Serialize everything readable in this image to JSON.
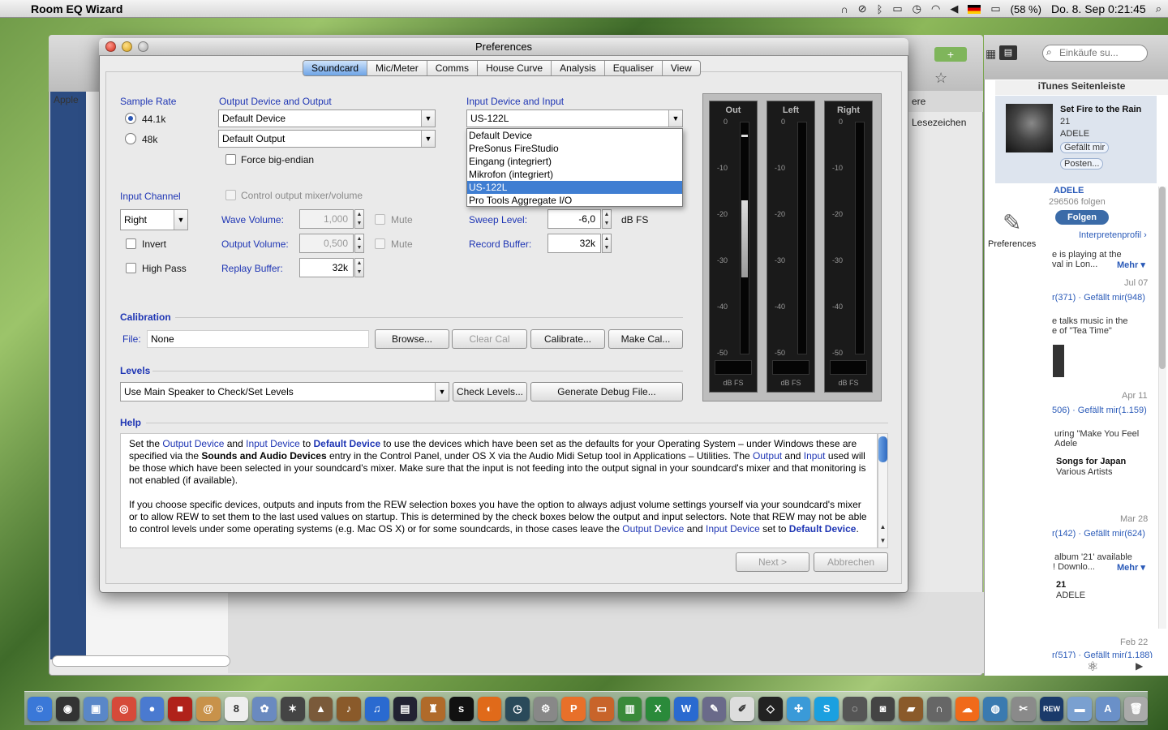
{
  "menubar": {
    "app_name": "Room EQ Wizard",
    "battery": "(58 %)",
    "clock": "Do. 8. Sep  0:21:45"
  },
  "background": {
    "apple_tab": "Apple",
    "lesezeichen": "ere Lesezeichen",
    "preferences_label": "Preferences"
  },
  "itunes": {
    "search_placeholder": "Einkäufe su...",
    "header": "iTunes Seitenleiste",
    "song": "Set Fire to the Rain",
    "album_num": "21",
    "artist": "ADELE",
    "like_btn": "Gefällt mir",
    "post_btn": "Posten...",
    "artist2": "ADELE",
    "followers": "296506 folgen",
    "follow_btn": "Folgen",
    "profile_link": "Interpretenprofil",
    "feed": [
      {
        "text1": "e is playing at the",
        "text2": "val in Lon...",
        "more": "Mehr",
        "date": "Jul 07",
        "stats": "r(371) · Gefällt mir(948)"
      },
      {
        "text1": "e talks music in the",
        "text2": "e of \"Tea Time\"",
        "date": "Apr 11",
        "stats": "506) · Gefällt mir(1.159)"
      },
      {
        "text1": "uring \"Make You Feel",
        "text2": "Adele",
        "title": "Songs for Japan",
        "sub": "Various Artists",
        "date": "Mar 28",
        "stats": "r(142) · Gefällt mir(624)"
      },
      {
        "text1": "album '21' available",
        "text2": "! Downlo...",
        "more": "Mehr",
        "title": "21",
        "sub": "ADELE",
        "date": "Feb 22",
        "stats": "r(517) · Gefällt mir(1.188)"
      }
    ]
  },
  "dialog": {
    "title": "Preferences",
    "tabs": [
      "Soundcard",
      "Mic/Meter",
      "Comms",
      "House Curve",
      "Analysis",
      "Equaliser",
      "View"
    ],
    "active_tab": "Soundcard",
    "sample_rate": {
      "label": "Sample Rate",
      "options": [
        "44.1k",
        "48k"
      ],
      "selected": "44.1k"
    },
    "output": {
      "label": "Output Device and Output",
      "device": "Default Device",
      "output": "Default Output",
      "force_big_endian": "Force big-endian"
    },
    "input": {
      "label": "Input Device and Input",
      "device": "US-122L",
      "dropdown_options": [
        "Default Device",
        "PreSonus FireStudio",
        "Eingang (integriert)",
        "Mikrofon (integriert)",
        "US-122L",
        "Pro Tools Aggregate I/O"
      ],
      "dropdown_selected": "US-122L"
    },
    "input_channel": {
      "label": "Input Channel",
      "value": "Right",
      "invert": "Invert",
      "high_pass": "High Pass"
    },
    "control_mixer": "Control output mixer/volume",
    "wave_volume": {
      "label": "Wave Volume:",
      "value": "1,000",
      "mute": "Mute"
    },
    "output_volume": {
      "label": "Output Volume:",
      "value": "0,500",
      "mute": "Mute"
    },
    "replay_buffer": {
      "label": "Replay Buffer:",
      "value": "32k"
    },
    "sweep_level": {
      "label": "Sweep Level:",
      "value": "-6,0",
      "unit": "dB FS"
    },
    "record_buffer": {
      "label": "Record Buffer:",
      "value": "32k"
    },
    "calibration": {
      "title": "Calibration",
      "file_label": "File:",
      "file_value": "None",
      "browse": "Browse...",
      "clear_cal": "Clear Cal",
      "calibrate": "Calibrate...",
      "make_cal": "Make Cal..."
    },
    "levels": {
      "title": "Levels",
      "mode": "Use Main Speaker to Check/Set Levels",
      "check_levels": "Check Levels...",
      "debug": "Generate Debug File..."
    },
    "meters": {
      "channels": [
        "Out",
        "Left",
        "Right"
      ],
      "ticks": [
        "0",
        "-10",
        "-20",
        "-30",
        "-40",
        "-50"
      ],
      "unit": "dB FS",
      "out_level_fraction": 0.33
    },
    "help": {
      "title": "Help",
      "p1": {
        "t1": "Set the ",
        "b1": "Output Device",
        "t2": " and ",
        "b2": "Input Device",
        "t3": " to ",
        "bb1": "Default Device",
        "t4": " to use the devices which have been set as the defaults for your Operating System – under Windows these are specified via the ",
        "bold1": "Sounds and Audio Devices",
        "t5": " entry in the Control Panel, under OS X via the Audio Midi Setup tool in Applications – Utilities. The ",
        "b3": "Output",
        "t6": " and ",
        "b4": "Input",
        "t7": " used will be those which have been selected in your soundcard's mixer. Make sure that the input is not feeding into the output signal in your soundcard's mixer and that monitoring is not enabled (if available)."
      },
      "p2": {
        "t1": "If you choose specific devices, outputs and inputs from the REW selection boxes you have the option to always adjust volume settings yourself via your soundcard's mixer or to allow REW to set them to the last used values on startup. This is determined by the check boxes below the output and input selectors. Note that REW may not be able to control levels under some operating systems (e.g. Mac OS X) or for some soundcards, in those cases leave the ",
        "b1": "Output Device",
        "t2": " and ",
        "b2": "Input Device",
        "t3": " set to ",
        "bb1": "Default Device",
        "t4": "."
      }
    },
    "next": "Next >",
    "cancel": "Abbrechen"
  },
  "dock": {
    "icons": [
      {
        "name": "finder-icon",
        "color": "#3a78d8",
        "glyph": "☺"
      },
      {
        "name": "dashboard-icon",
        "color": "#333",
        "glyph": "◉"
      },
      {
        "name": "preview-icon",
        "color": "#5a87c8",
        "glyph": "▣"
      },
      {
        "name": "chrome-icon",
        "color": "#d64a3a",
        "glyph": "◎"
      },
      {
        "name": "facetime-icon",
        "color": "#4a7ad0",
        "glyph": "●"
      },
      {
        "name": "photobooth-icon",
        "color": "#b0221a",
        "glyph": "■"
      },
      {
        "name": "addressbook-icon",
        "color": "#c8924a",
        "glyph": "@"
      },
      {
        "name": "ical-icon",
        "color": "#eeeeee",
        "glyph": "8"
      },
      {
        "name": "iphoto-icon",
        "color": "#6a8ac0",
        "glyph": "✿"
      },
      {
        "name": "aperture-icon",
        "color": "#444",
        "glyph": "✶"
      },
      {
        "name": "iphoto2-icon",
        "color": "#7a5a3a",
        "glyph": "▲"
      },
      {
        "name": "garageband-icon",
        "color": "#8a5a2a",
        "glyph": "♪"
      },
      {
        "name": "itunes-icon",
        "color": "#2a6ad0",
        "glyph": "♫"
      },
      {
        "name": "mainstage-icon",
        "color": "#223",
        "glyph": "▤"
      },
      {
        "name": "instruments-icon",
        "color": "#b06a2a",
        "glyph": "♜"
      },
      {
        "name": "solo-icon",
        "color": "#111",
        "glyph": "s"
      },
      {
        "name": "firefox-icon",
        "color": "#e06a1a",
        "glyph": "◐"
      },
      {
        "name": "timemachine-icon",
        "color": "#2a4a5a",
        "glyph": "◷"
      },
      {
        "name": "systemprefs-icon",
        "color": "#888",
        "glyph": "⚙"
      },
      {
        "name": "pages-icon",
        "color": "#e8702a",
        "glyph": "P"
      },
      {
        "name": "keynote-icon",
        "color": "#c8642a",
        "glyph": "▭"
      },
      {
        "name": "numbers-icon",
        "color": "#3a8a3a",
        "glyph": "▥"
      },
      {
        "name": "excel-icon",
        "color": "#2a8a3a",
        "glyph": "X"
      },
      {
        "name": "word-icon",
        "color": "#2a6ad0",
        "glyph": "W"
      },
      {
        "name": "script-icon",
        "color": "#6a6a8a",
        "glyph": "✎"
      },
      {
        "name": "textedit-icon",
        "color": "#ddd",
        "glyph": "✐"
      },
      {
        "name": "unity-icon",
        "color": "#222",
        "glyph": "◇"
      },
      {
        "name": "network-icon",
        "color": "#3a9ad8",
        "glyph": "✣"
      },
      {
        "name": "skype-icon",
        "color": "#1aa0e0",
        "glyph": "S"
      },
      {
        "name": "dvd-icon",
        "color": "#555",
        "glyph": "◌"
      },
      {
        "name": "camera-icon",
        "color": "#444",
        "glyph": "◙"
      },
      {
        "name": "wallet-icon",
        "color": "#8a5a2a",
        "glyph": "▰"
      },
      {
        "name": "headphones-icon",
        "color": "#666",
        "glyph": "∩"
      },
      {
        "name": "soundcloud-icon",
        "color": "#f06a1a",
        "glyph": "☁"
      },
      {
        "name": "globe-icon",
        "color": "#3a7ab0",
        "glyph": "◍"
      },
      {
        "name": "utility-icon",
        "color": "#8a8a8a",
        "glyph": "✂"
      },
      {
        "name": "rew-icon",
        "color": "#1a3a6a",
        "glyph": "REW"
      },
      {
        "name": "folder-icon",
        "color": "#7aa0d0",
        "glyph": "▬"
      },
      {
        "name": "applications-icon",
        "color": "#6a90c8",
        "glyph": "A"
      },
      {
        "name": "trash-icon",
        "color": "#aaa",
        "glyph": "🗑"
      }
    ]
  }
}
